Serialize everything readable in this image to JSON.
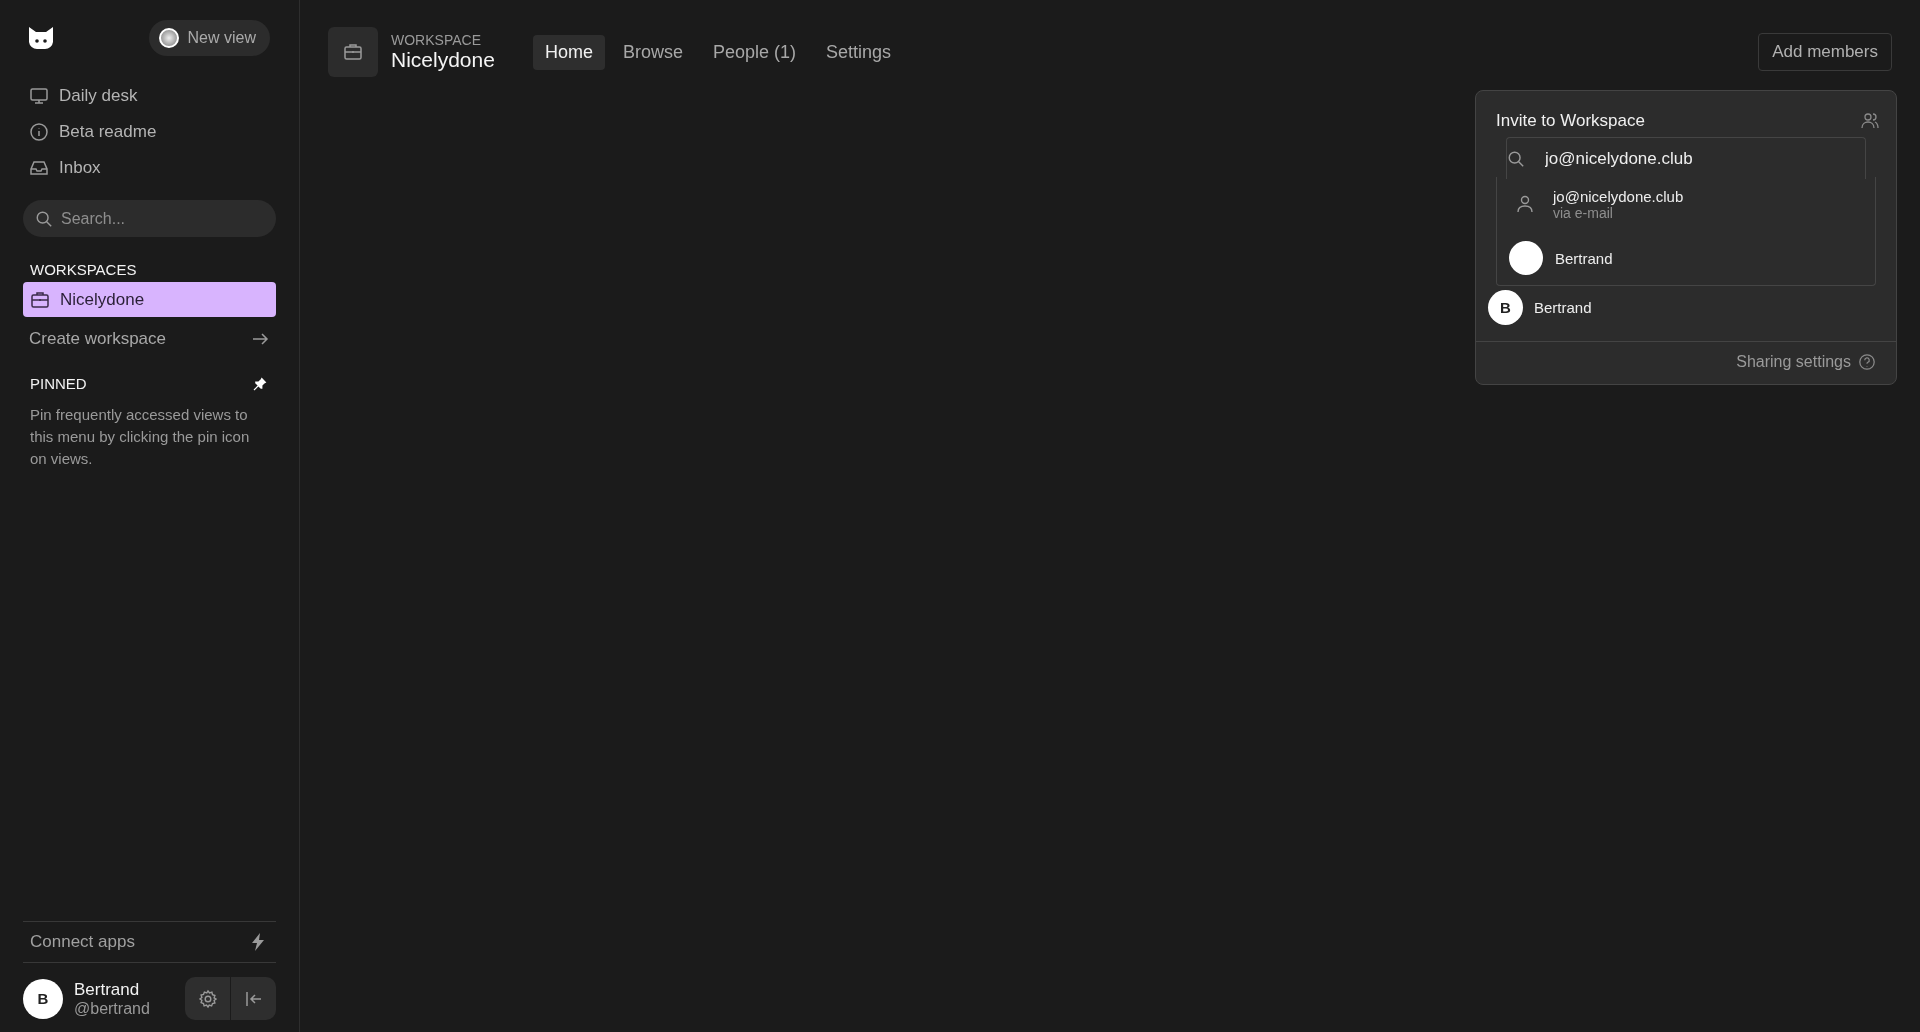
{
  "sidebar": {
    "new_view": "New view",
    "nav": [
      {
        "label": "Daily desk",
        "kind": "monitor"
      },
      {
        "label": "Beta readme",
        "kind": "info"
      },
      {
        "label": "Inbox",
        "kind": "inbox"
      }
    ],
    "search": {
      "placeholder": "Search..."
    },
    "workspaces_heading": "WORKSPACES",
    "workspaces": [
      {
        "label": "Nicelydone",
        "selected": true
      }
    ],
    "create_workspace": "Create workspace",
    "pinned_heading": "PINNED",
    "pinned_hint": "Pin frequently accessed views to this menu by clicking the pin icon on views.",
    "connect_apps": "Connect apps",
    "user": {
      "initial": "B",
      "name": "Bertrand",
      "handle": "@bertrand"
    }
  },
  "header": {
    "label": "WORKSPACE",
    "title": "Nicelydone",
    "tabs": [
      {
        "label": "Home",
        "selected": true
      },
      {
        "label": "Browse",
        "selected": false
      },
      {
        "label": "People (1)",
        "selected": false
      },
      {
        "label": "Settings",
        "selected": false
      }
    ],
    "add_members": "Add members"
  },
  "invite": {
    "title": "Invite to Workspace",
    "field": {
      "value": "jo@nicelydone.club"
    },
    "suggestions": [
      {
        "kind": "email",
        "label": "jo@nicelydone.club",
        "sub": "via e-mail"
      },
      {
        "kind": "user",
        "label": "Bertrand"
      }
    ],
    "members": [
      {
        "initial": "B",
        "name": "Bertrand"
      }
    ],
    "sharing_settings": "Sharing settings"
  }
}
